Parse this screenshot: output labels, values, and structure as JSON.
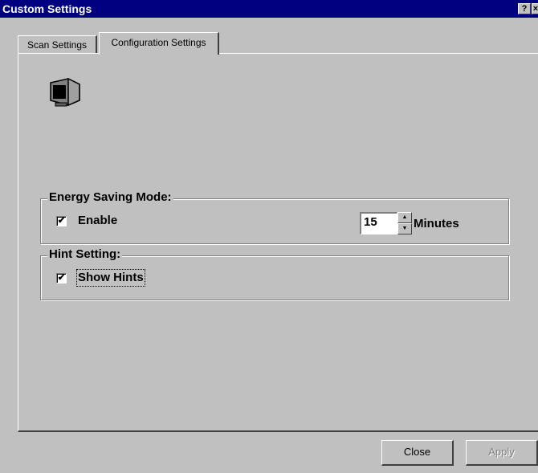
{
  "window": {
    "title": "Custom Settings",
    "help_label": "?",
    "close_label": "×"
  },
  "tabs": [
    {
      "label": "Scan Settings",
      "active": false
    },
    {
      "label": "Configuration Settings",
      "active": true
    }
  ],
  "icon": "monitor-power-save-icon",
  "energy_saving": {
    "title": "Energy Saving Mode:",
    "enable_label": "Enable",
    "enable_checked": true,
    "minutes_value": "15",
    "minutes_label": "Minutes"
  },
  "hint_setting": {
    "title": "Hint Setting:",
    "show_hints_label": "Show Hints",
    "show_hints_checked": true
  },
  "buttons": {
    "close_label": "Close",
    "apply_label": "Apply",
    "apply_enabled": false
  },
  "glyphs": {
    "check": "✔",
    "up": "▲",
    "down": "▼"
  }
}
